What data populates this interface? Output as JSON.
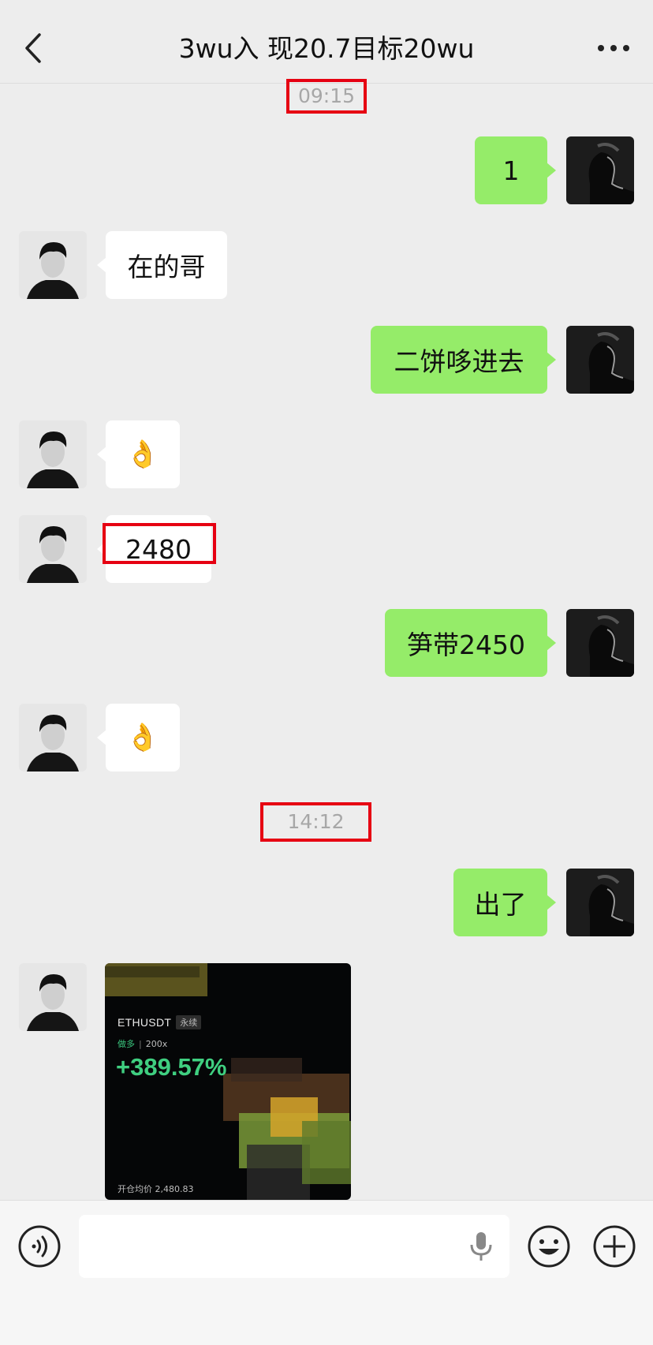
{
  "header": {
    "title": "3wu入 现20.7目标20wu"
  },
  "timestamps": [
    "09:15",
    "14:12"
  ],
  "messages": [
    {
      "from": "me",
      "text": "1"
    },
    {
      "from": "other",
      "text": "在的哥"
    },
    {
      "from": "me",
      "text": "二饼哆进去"
    },
    {
      "from": "other",
      "text": "👌"
    },
    {
      "from": "other",
      "text": "2480"
    },
    {
      "from": "me",
      "text": "笋带2450"
    },
    {
      "from": "other",
      "text": "👌"
    },
    {
      "from": "me",
      "text": "出了"
    }
  ],
  "trade_card": {
    "pair": "ETHUSDT",
    "tag": "永续",
    "side": "做多",
    "leverage": "200x",
    "pnl": "+389.57%",
    "entry_label": "开仓均价",
    "entry_value": "2,480.83"
  },
  "colors": {
    "my_bubble": "#95ec69",
    "other_bubble": "#ffffff",
    "highlight": "#e60012",
    "profit": "#3fcf80"
  },
  "icons": [
    "back-chevron-icon",
    "more-dots-icon",
    "voice-icon",
    "mic-icon",
    "emoji-icon",
    "plus-icon"
  ]
}
